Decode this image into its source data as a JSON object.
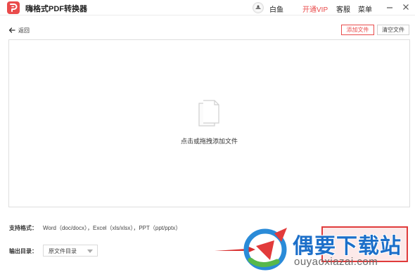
{
  "app": {
    "title": "嗨格式PDF转换器"
  },
  "header": {
    "username": "白鱼",
    "vip_label": "开通VIP",
    "service_label": "客服",
    "menu_label": "菜单"
  },
  "toolbar": {
    "back_label": "返回",
    "add_file_label": "添加文件",
    "clear_file_label": "清空文件"
  },
  "dropzone": {
    "hint": "点击或拖拽添加文件"
  },
  "footer": {
    "formats_label": "支持格式：",
    "formats_value": "Word（doc/docx），Excel（xls/xlsx），PPT（ppt/pptx）",
    "output_label": "输出目录：",
    "output_value": "原文件目录"
  },
  "watermark": {
    "title": "偶要下载站",
    "url": "ouyaoxiazai.com"
  },
  "colors": {
    "accent": "#e94b4b",
    "watermark_blue": "#1c6fc9"
  }
}
